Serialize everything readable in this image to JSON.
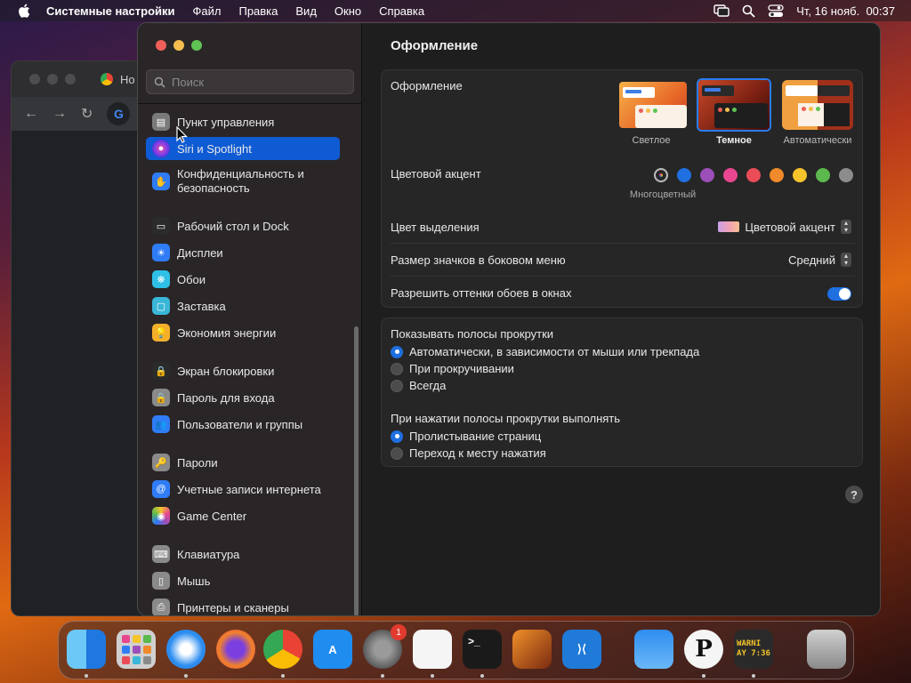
{
  "menubar": {
    "app_name": "Системные настройки",
    "items": [
      "Файл",
      "Правка",
      "Вид",
      "Окно",
      "Справка"
    ],
    "clock": "Чт, 16 нояб.  00:37"
  },
  "background_window": {
    "tab_label": "Но"
  },
  "sidebar": {
    "search_placeholder": "Поиск",
    "items": [
      {
        "label": "Пункт управления",
        "icon": "control-center-icon",
        "color": "#7a7a7a"
      },
      {
        "label": "Siri и Spotlight",
        "icon": "siri-icon",
        "color": "#8e3fd6",
        "selected": true
      },
      {
        "label": "Конфиденциальность и безопасность",
        "icon": "hand-icon",
        "color": "#2f7cf6"
      },
      {
        "label": "Рабочий стол и Dock",
        "icon": "desktop-dock-icon",
        "color": "#2b2b2b"
      },
      {
        "label": "Дисплеи",
        "icon": "display-icon",
        "color": "#2f7cf6"
      },
      {
        "label": "Обои",
        "icon": "wallpaper-icon",
        "color": "#2ec0e6"
      },
      {
        "label": "Заставка",
        "icon": "screensaver-icon",
        "color": "#39b6d8"
      },
      {
        "label": "Экономия энергии",
        "icon": "bulb-icon",
        "color": "#f5b02a"
      },
      {
        "label": "Экран блокировки",
        "icon": "lock-icon",
        "color": "#2b2b2b"
      },
      {
        "label": "Пароль для входа",
        "icon": "lock-icon",
        "color": "#8a8a8a"
      },
      {
        "label": "Пользователи и группы",
        "icon": "users-icon",
        "color": "#2f7cf6"
      },
      {
        "label": "Пароли",
        "icon": "key-icon",
        "color": "#8a8a8a"
      },
      {
        "label": "Учетные записи интернета",
        "icon": "at-icon",
        "color": "#2f7cf6"
      },
      {
        "label": "Game Center",
        "icon": "game-center-icon",
        "color": "#e0e0e0"
      },
      {
        "label": "Клавиатура",
        "icon": "keyboard-icon",
        "color": "#8a8a8a"
      },
      {
        "label": "Мышь",
        "icon": "mouse-icon",
        "color": "#8a8a8a"
      },
      {
        "label": "Принтеры и сканеры",
        "icon": "printer-icon",
        "color": "#8a8a8a"
      }
    ]
  },
  "main": {
    "title": "Оформление",
    "appearance": {
      "label": "Оформление",
      "options": [
        {
          "label": "Светлое",
          "selected": false
        },
        {
          "label": "Темное",
          "selected": true
        },
        {
          "label": "Автоматически",
          "selected": false
        }
      ]
    },
    "accent": {
      "label": "Цветовой акцент",
      "selected_caption": "Многоцветный",
      "colors": [
        "multicolor",
        "#1f6fe0",
        "#9b4fb8",
        "#e8478f",
        "#ea4c58",
        "#f08a2a",
        "#f5c42b",
        "#5cb94d",
        "#8c8c8c"
      ]
    },
    "highlight": {
      "label": "Цвет выделения",
      "value": "Цветовой акцент"
    },
    "sidebar_icon_size": {
      "label": "Размер значков в боковом меню",
      "value": "Средний"
    },
    "wallpaper_tinting": {
      "label": "Разрешить оттенки обоев в окнах",
      "enabled": true
    },
    "scrollbars": {
      "label": "Показывать полосы прокрутки",
      "options": [
        {
          "label": "Автоматически, в зависимости от мыши или трекпада",
          "selected": true
        },
        {
          "label": "При прокручивании",
          "selected": false
        },
        {
          "label": "Всегда",
          "selected": false
        }
      ]
    },
    "click_scrollbar": {
      "label": "При нажатии полосы прокрутки выполнять",
      "options": [
        {
          "label": "Пролистывание страниц",
          "selected": true
        },
        {
          "label": "Переход к месту нажатия",
          "selected": false
        }
      ]
    },
    "help_label": "?"
  },
  "dock": {
    "badge": "1",
    "items": [
      {
        "name": "finder-icon"
      },
      {
        "name": "launchpad-icon"
      },
      {
        "name": "safari-icon"
      },
      {
        "name": "firefox-icon"
      },
      {
        "name": "chrome-icon"
      },
      {
        "name": "app-store-icon"
      },
      {
        "name": "system-settings-icon"
      },
      {
        "name": "textedit-icon"
      },
      {
        "name": "terminal-icon"
      },
      {
        "name": "garageband-icon"
      },
      {
        "name": "vscode-icon"
      },
      {
        "name": "weather-icon"
      },
      {
        "name": "p-app-icon"
      },
      {
        "name": "console-icon"
      },
      {
        "name": "trash-icon"
      }
    ],
    "console_text": "WARNI\nAY 7:36",
    "p_letter": "P"
  }
}
